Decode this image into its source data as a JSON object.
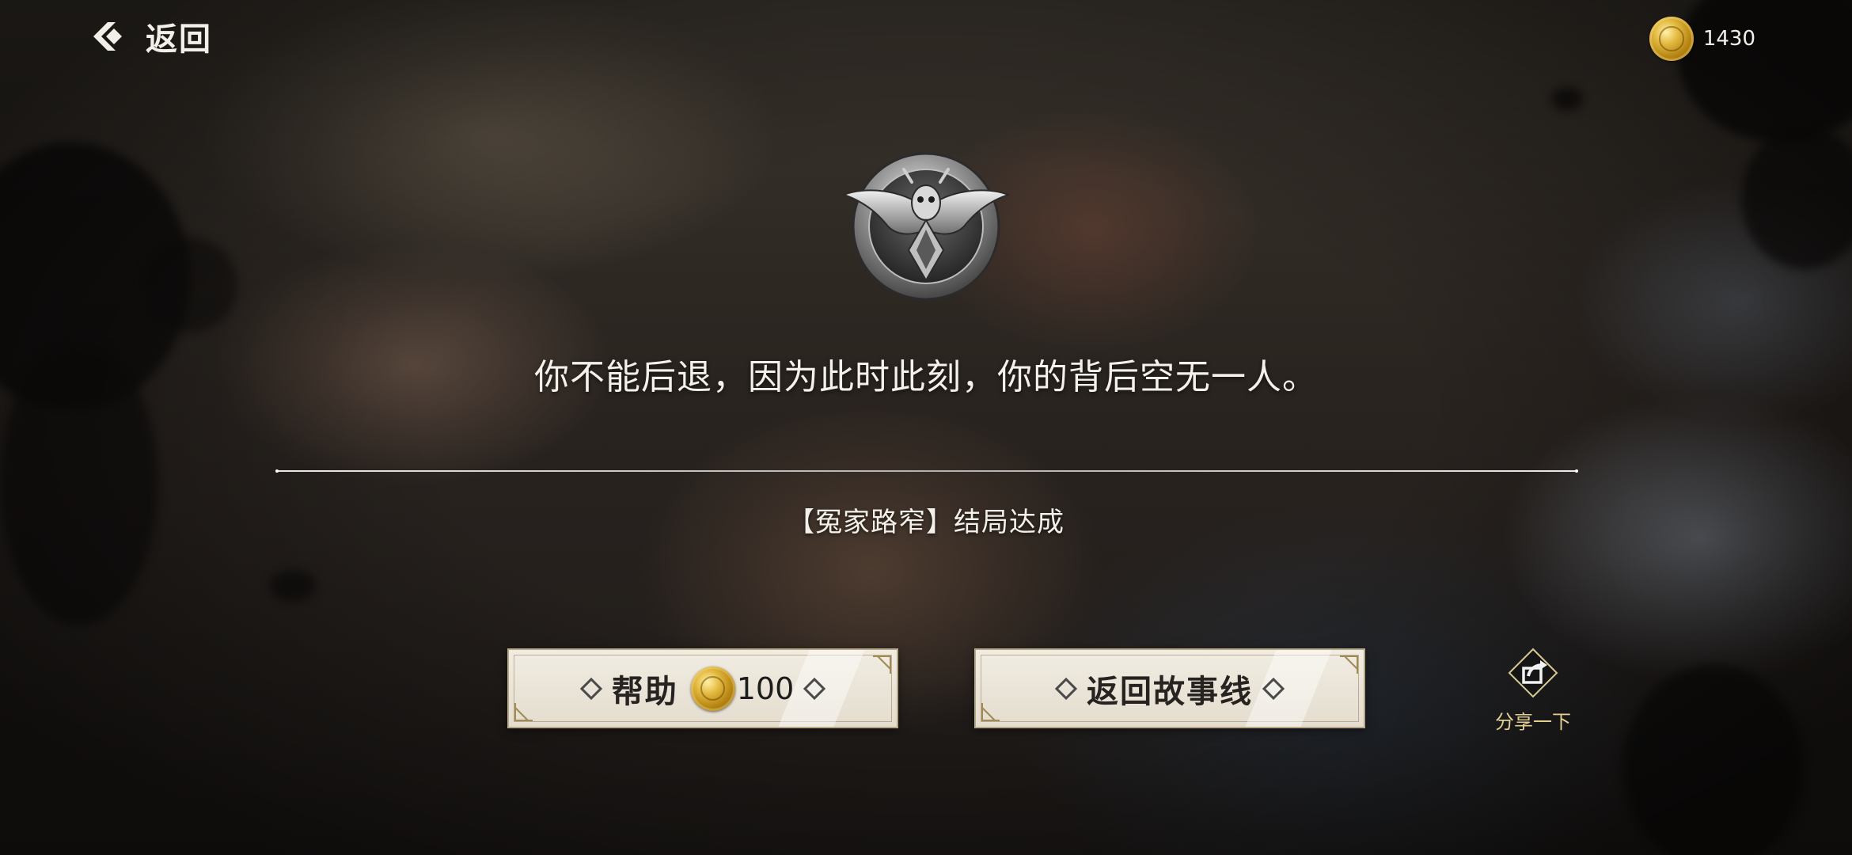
{
  "top_bar": {
    "back_label": "返回",
    "currency_value": "1430",
    "currency_icon": "gold-coin-icon"
  },
  "emblem": {
    "icon": "winged-beetle-medal-icon"
  },
  "quote": "你不能后退，因为此时此刻，你的背后空无一人。",
  "ending": "【冤家路窄】结局达成",
  "buttons": {
    "help_label": "帮助",
    "help_cost": "100",
    "story_label": "返回故事线"
  },
  "share": {
    "label": "分享一下",
    "icon": "share-arrow-icon"
  },
  "colors": {
    "text_light": "#f4f1ec",
    "button_paper": "#eae4d8",
    "button_text": "#262320",
    "share_label": "#e4cf92",
    "coin_gold": "#d4a72c"
  }
}
